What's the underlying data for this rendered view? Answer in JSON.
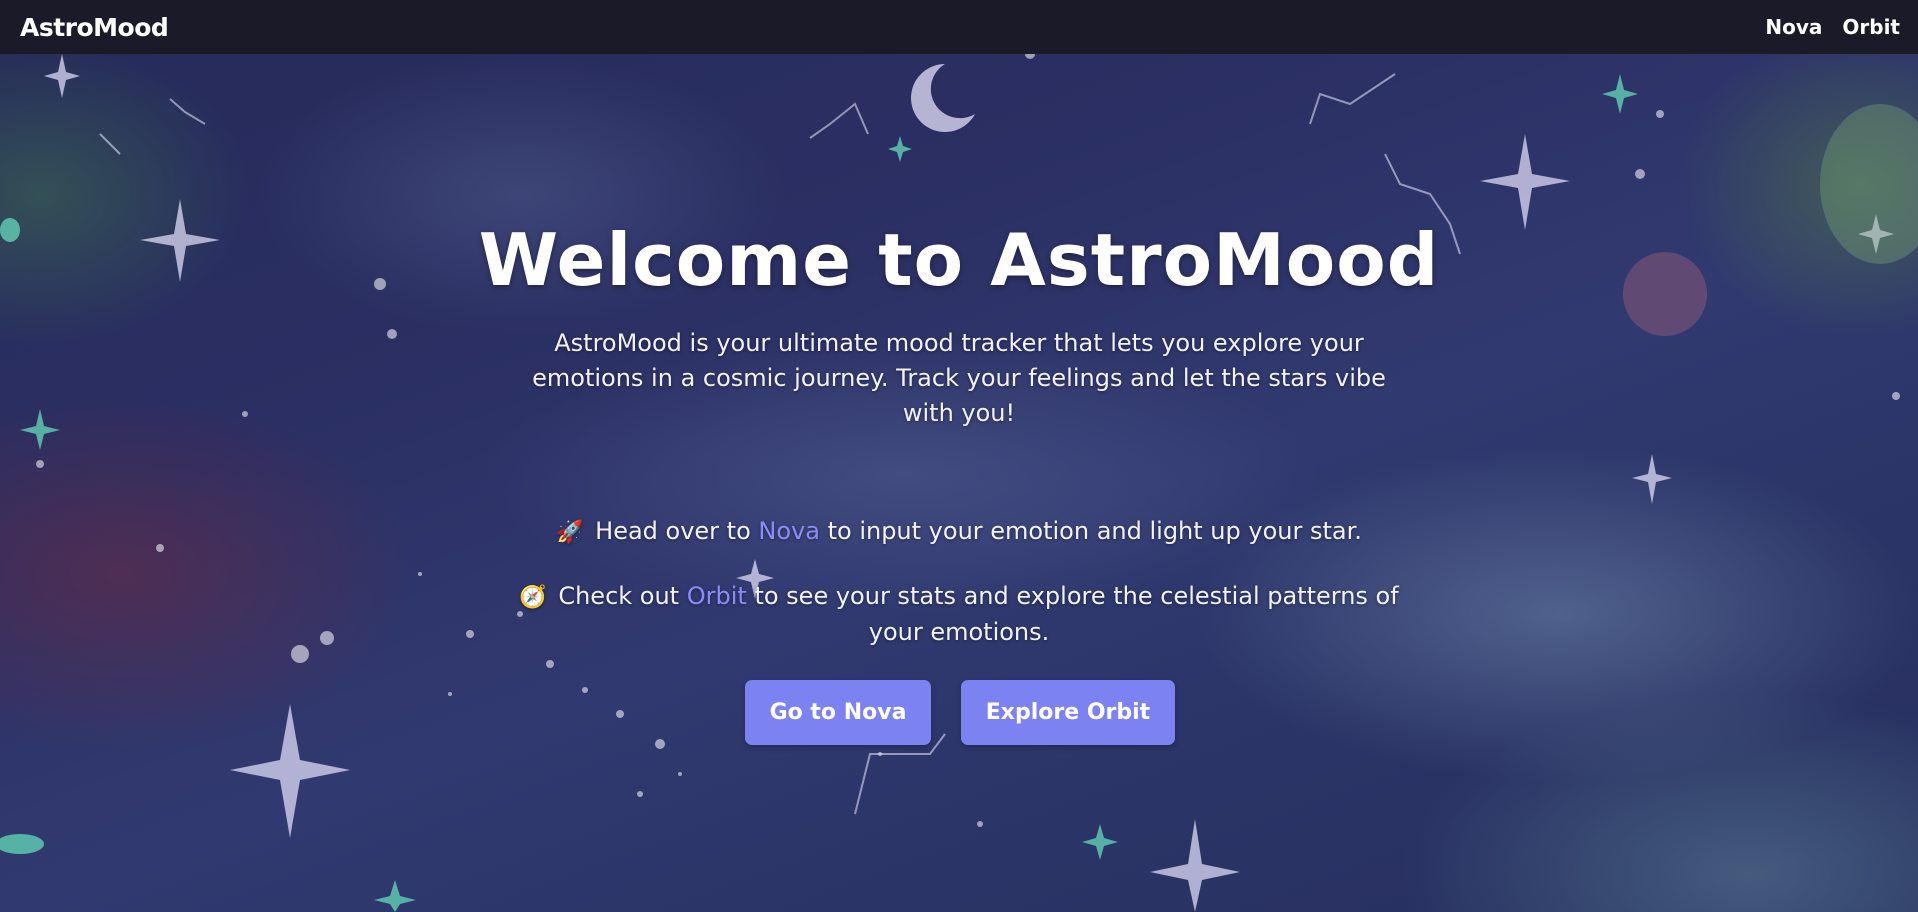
{
  "navbar": {
    "brand": "AstroMood",
    "links": [
      "Nova",
      "Orbit"
    ]
  },
  "hero": {
    "title": "Welcome to AstroMood",
    "description": "AstroMood is your ultimate mood tracker that lets you explore your emotions in a cosmic journey. Track your feelings and let the stars vibe with you!",
    "nova_line": {
      "emoji": "🚀",
      "before": "Head over to",
      "link": "Nova",
      "after": "to input your emotion and light up your star."
    },
    "orbit_line": {
      "emoji": "🧭",
      "before": "Check out",
      "link": "Orbit",
      "after": "to see your stats and explore the celestial patterns of your emotions."
    },
    "buttons": {
      "nova": "Go to Nova",
      "orbit": "Explore Orbit"
    }
  },
  "colors": {
    "navbar_bg": "#1b1a28",
    "accent": "#7c82f2",
    "link": "#8b8cf8",
    "background": "#2b2f63"
  }
}
